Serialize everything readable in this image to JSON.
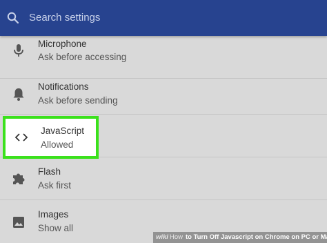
{
  "search": {
    "placeholder": "Search settings"
  },
  "settings": {
    "microphone": {
      "title": "Microphone",
      "subtitle": "Ask before accessing"
    },
    "notifications": {
      "title": "Notifications",
      "subtitle": "Ask before sending"
    },
    "javascript": {
      "title": "JavaScript",
      "subtitle": "Allowed"
    },
    "flash": {
      "title": "Flash",
      "subtitle": "Ask first"
    },
    "images": {
      "title": "Images",
      "subtitle": "Show all"
    }
  },
  "watermark": {
    "logo": "wiki",
    "brand": "How",
    "text": "to Turn Off Javascript on Chrome on PC or Mac"
  },
  "colors": {
    "header": "#27438f",
    "background": "#d9d9d9",
    "highlight": "#3be11c"
  },
  "icons": {
    "search": "search-icon",
    "microphone": "microphone-icon",
    "notifications": "bell-icon",
    "javascript": "code-brackets-icon",
    "flash": "puzzle-icon",
    "images": "image-icon"
  }
}
